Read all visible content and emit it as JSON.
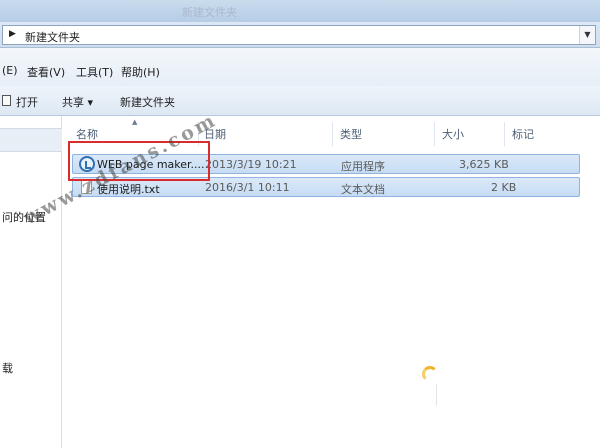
{
  "window": {
    "ghost_title": "新建文件夹"
  },
  "address": {
    "path": "新建文件夹"
  },
  "menu": {
    "items": [
      "(E)",
      "查看(V)",
      "工具(T)",
      "帮助(H)"
    ]
  },
  "toolbar": {
    "open": "打开",
    "share": "共享 ▾",
    "new_folder": "新建文件夹"
  },
  "sidebar": {
    "items": [
      "问的位置",
      "载"
    ]
  },
  "columns": {
    "name": "名称",
    "date": "日期",
    "type": "类型",
    "size": "大小",
    "tag": "标记"
  },
  "files": [
    {
      "name": "WEB page maker....",
      "date": "2013/3/19 10:21",
      "type": "应用程序",
      "size": "3,625 KB",
      "icon": "app-icon"
    },
    {
      "name": "使用说明.txt",
      "date": "2016/3/1 10:11",
      "type": "文本文档",
      "size": "2 KB",
      "icon": "txt-file-icon"
    }
  ],
  "watermark": "www.zdfans.com",
  "colors": {
    "highlight": "#d92d2d",
    "selection": "#c6dcf4",
    "accent": "#2f6fb5"
  }
}
